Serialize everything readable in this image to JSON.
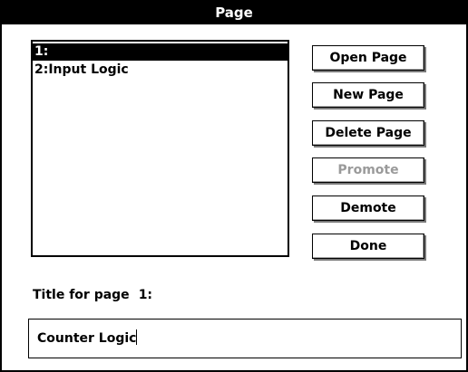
{
  "window": {
    "title": "Page"
  },
  "page_list": {
    "items": [
      {
        "label": "1:",
        "selected": true
      },
      {
        "label": "2:Input Logic",
        "selected": false
      }
    ]
  },
  "buttons": {
    "open_page": {
      "label": "Open Page",
      "enabled": true
    },
    "new_page": {
      "label": "New Page",
      "enabled": true
    },
    "delete_page": {
      "label": "Delete Page",
      "enabled": true
    },
    "promote": {
      "label": "Promote",
      "enabled": false
    },
    "demote": {
      "label": "Demote",
      "enabled": true
    },
    "done": {
      "label": "Done",
      "enabled": true
    }
  },
  "title_field": {
    "label": "Title for page",
    "page_number": "1:",
    "value": "Counter Logic"
  }
}
